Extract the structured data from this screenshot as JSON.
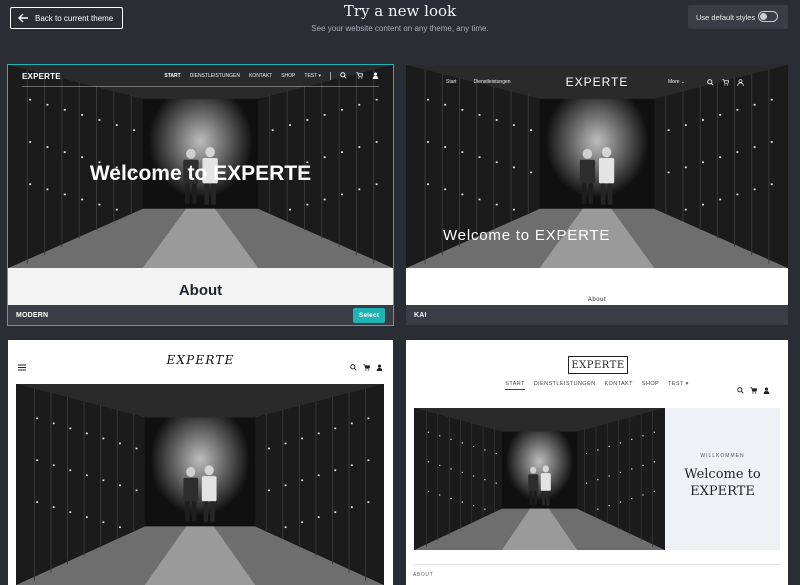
{
  "header": {
    "back_label": "Back to current theme",
    "title": "Try a new look",
    "subtitle": "See your website content on any theme, any time.",
    "default_styles_label": "Use default styles",
    "default_styles_on": false
  },
  "accent_color": "#1fb3b3",
  "cards": [
    {
      "name": "MODERN",
      "selected": true,
      "select_label": "Select",
      "logo": "EXPERTE",
      "nav": [
        "START",
        "DIENSTLEISTUNGEN",
        "KONTAKT",
        "SHOP",
        "TEST"
      ],
      "hero": "Welcome to EXPERTE",
      "section": "About"
    },
    {
      "name": "KAI",
      "logo": "EXPERTE",
      "nav_left": [
        "Start",
        "Dienstleistungen"
      ],
      "nav_more": "More",
      "hero": "Welcome to EXPERTE",
      "section": "About"
    },
    {
      "logo": "EXPERTE"
    },
    {
      "logo": "EXPERTE",
      "nav": [
        "START",
        "DIENSTLEISTUNGEN",
        "KONTAKT",
        "SHOP",
        "TEST"
      ],
      "kicker": "WILLKOMMEN",
      "hero_line1": "Welcome to",
      "hero_line2": "EXPERTE",
      "section": "ABOUT"
    }
  ]
}
